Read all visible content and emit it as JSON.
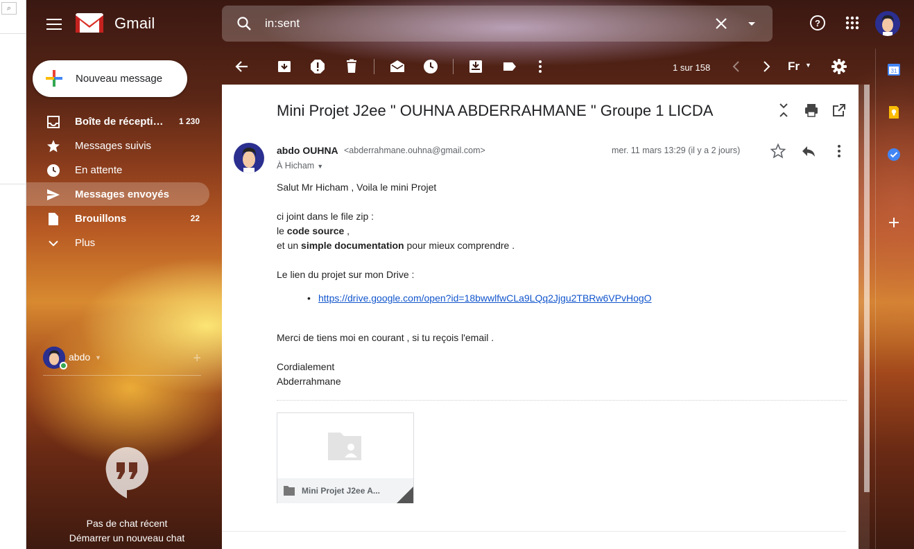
{
  "header": {
    "app_title": "Gmail",
    "search_value": "in:sent"
  },
  "compose": {
    "label": "Nouveau message"
  },
  "nav": [
    {
      "label": "Boîte de récepti…",
      "count": "1 230",
      "bold": true
    },
    {
      "label": "Messages suivis",
      "count": "",
      "bold": false
    },
    {
      "label": "En attente",
      "count": "",
      "bold": false
    },
    {
      "label": "Messages envoyés",
      "count": "",
      "bold": true
    },
    {
      "label": "Brouillons",
      "count": "22",
      "bold": true
    },
    {
      "label": "Plus",
      "count": "",
      "bold": false
    }
  ],
  "user": {
    "name": "abdo"
  },
  "chat": {
    "empty": "Pas de chat récent",
    "start": "Démarrer un nouveau chat"
  },
  "toolbar": {
    "pager": "1 sur 158",
    "input_tool": "Fr"
  },
  "email": {
    "subject": "Mini Projet J2ee \" OUHNA ABDERRAHMANE \" Groupe 1 LICDA",
    "sender_name": "abdo OUHNA",
    "sender_email": "<abderrahmane.ouhna@gmail.com>",
    "date": "mer. 11 mars 13:29 (il y a 2 jours)",
    "to": "À Hicham",
    "greeting": "Salut Mr Hicham , Voila le mini Projet",
    "line_zip": "ci joint dans le file zip :",
    "line_code_pre": "le ",
    "line_code_bold": "code source",
    "line_code_post": " ,",
    "line_doc_pre": "et un ",
    "line_doc_bold": "simple documentation",
    "line_doc_post": " pour mieux comprendre .",
    "drive_intro": "Le lien du projet sur mon Drive :",
    "drive_link": "https://drive.google.com/open?id=18bwwlfwCLa9LQq2Jjgu2TBRw6VPvHogO",
    "thanks": "Merci de tiens moi en courant , si tu reçois l'email .",
    "signoff": "Cordialement",
    "signature": "Abderrahmane",
    "attachment_name": "Mini Projet J2ee A..."
  },
  "colors": {
    "accent_blue": "#1155cc",
    "online_green": "#36a852"
  }
}
